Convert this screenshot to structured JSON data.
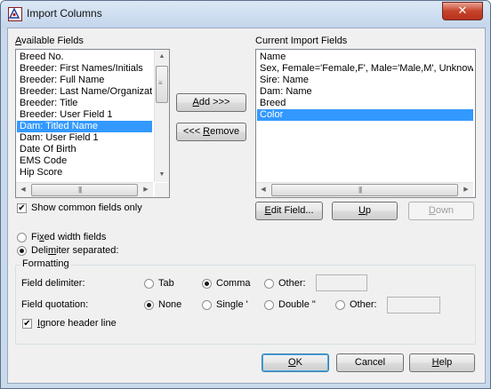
{
  "window": {
    "title": "Import Columns",
    "close_glyph": "✕"
  },
  "available": {
    "label_pre": "",
    "label_key": "A",
    "label_post": "vailable Fields",
    "items": [
      {
        "label": "Breed No.",
        "selected": false
      },
      {
        "label": "Breeder: First Names/Initials",
        "selected": false
      },
      {
        "label": "Breeder: Full Name",
        "selected": false
      },
      {
        "label": "Breeder: Last Name/Organization",
        "selected": false
      },
      {
        "label": "Breeder: Title",
        "selected": false
      },
      {
        "label": "Breeder: User Field 1",
        "selected": false
      },
      {
        "label": "Dam: Titled Name",
        "selected": true
      },
      {
        "label": "Dam: User Field 1",
        "selected": false
      },
      {
        "label": "Date Of Birth",
        "selected": false
      },
      {
        "label": "EMS Code",
        "selected": false
      },
      {
        "label": "Hip Score",
        "selected": false
      }
    ]
  },
  "current": {
    "label": "Current Import Fields",
    "items": [
      {
        "label": "Name",
        "selected": false
      },
      {
        "label": "Sex, Female='Female,F', Male='Male,M', Unknown='",
        "selected": false
      },
      {
        "label": "Sire: Name",
        "selected": false
      },
      {
        "label": "Dam: Name",
        "selected": false
      },
      {
        "label": "Breed",
        "selected": false
      },
      {
        "label": "Color",
        "selected": true
      }
    ]
  },
  "buttons": {
    "add_key": "A",
    "add_rest": "dd >>>",
    "remove_pre": "<<< ",
    "remove_key": "R",
    "remove_rest": "emove",
    "edit_key": "E",
    "edit_rest": "dit Field...",
    "up_key": "U",
    "up_rest": "p",
    "down_key": "D",
    "down_rest": "own",
    "ok_key": "O",
    "ok_rest": "K",
    "cancel": "Cancel",
    "help_key": "H",
    "help_rest": "elp"
  },
  "options": {
    "show_common": "Show common fields only",
    "show_common_checked": true,
    "fixed_pre": "Fi",
    "fixed_key": "x",
    "fixed_post": "ed width fields",
    "fixed_selected": false,
    "delim_pre": "Deli",
    "delim_key": "m",
    "delim_post": "iter separated:",
    "delim_selected": true
  },
  "formatting": {
    "title": "Formatting",
    "delimiter_label": "Field delimiter:",
    "delim_tab": "Tab",
    "delim_comma": "Comma",
    "delim_other": "Other:",
    "delim_selected": "comma",
    "quotation_label": "Field quotation:",
    "q_none": "None",
    "q_single": "Single '",
    "q_double": "Double \"",
    "q_other": "Other:",
    "quotation_selected": "none",
    "ignore_header_key": "I",
    "ignore_header_rest": "gnore header line",
    "ignore_header_checked": true,
    "check_glyph": "✔"
  },
  "scroll_glyphs": {
    "up": "▲",
    "down": "▼",
    "left": "◀",
    "right": "▶",
    "grip_v": "≡",
    "grip_h": "|||"
  }
}
